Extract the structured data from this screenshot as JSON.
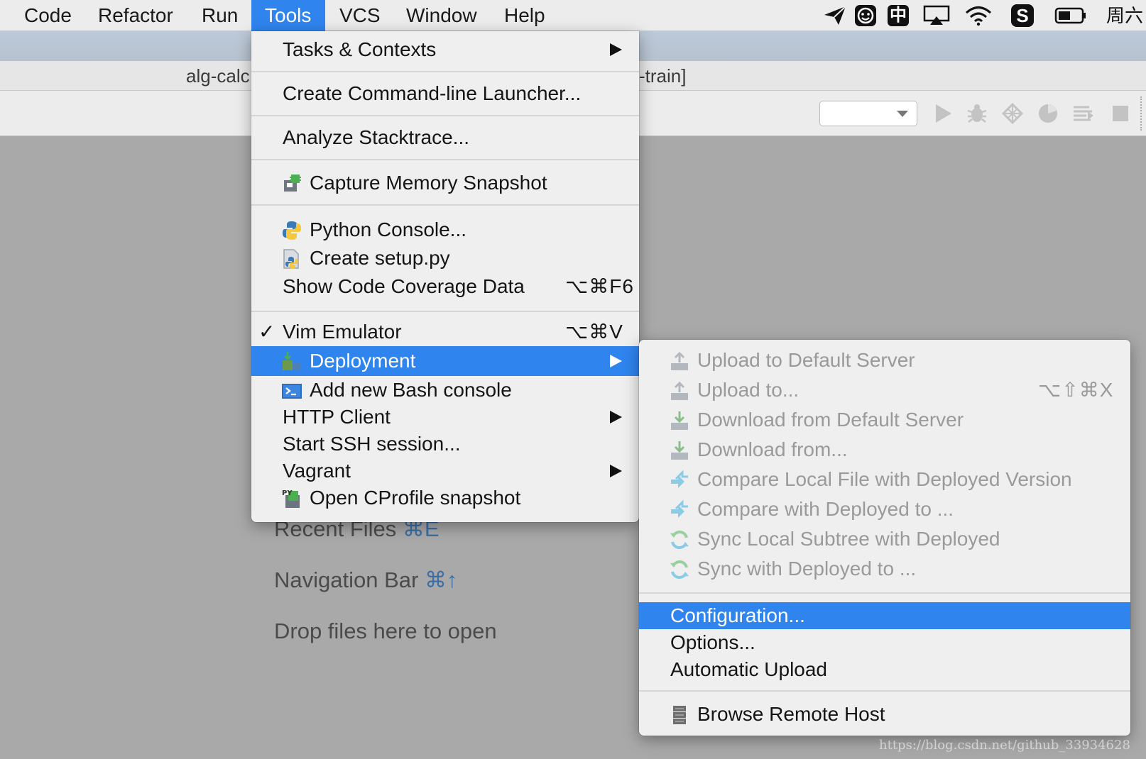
{
  "menubar": {
    "items": [
      {
        "label": "Code",
        "active": false
      },
      {
        "label": "Refactor",
        "active": false
      },
      {
        "label": "Run",
        "active": false
      },
      {
        "label": "Tools",
        "active": true
      },
      {
        "label": "VCS",
        "active": false
      },
      {
        "label": "Window",
        "active": false
      },
      {
        "label": "Help",
        "active": false
      }
    ],
    "status_icons": [
      "send-icon",
      "smiley-icon",
      "input-method-icon",
      "airplay-icon",
      "wifi-icon",
      "sogou-icon",
      "battery-icon"
    ],
    "input_method_label": "中",
    "sogou_label": "S",
    "clock_text": "周六"
  },
  "window": {
    "title_left": "alg-calc",
    "title_right": "-train]"
  },
  "welcome": {
    "recent_files_label": "Recent Files",
    "recent_files_shortcut": "⌘E",
    "navigation_bar_label": "Navigation Bar",
    "navigation_bar_shortcut": "⌘↑",
    "drop_files_label": "Drop files here to open"
  },
  "tools_menu": {
    "tasks_contexts": "Tasks & Contexts",
    "create_launcher": "Create Command-line Launcher...",
    "analyze_stacktrace": "Analyze Stacktrace...",
    "capture_memory": "Capture Memory Snapshot",
    "python_console": "Python Console...",
    "create_setup": "Create setup.py",
    "show_coverage": "Show Code Coverage Data",
    "show_coverage_shortcut": "⌥⌘F6",
    "vim_emulator": "Vim Emulator",
    "vim_checked": "✓",
    "vim_shortcut": "⌥⌘V",
    "deployment": "Deployment",
    "add_bash": "Add new Bash console",
    "http_client": "HTTP Client",
    "start_ssh": "Start SSH session...",
    "vagrant": "Vagrant",
    "open_cprofile": "Open CProfile snapshot"
  },
  "deployment_menu": {
    "upload_default": "Upload to Default Server",
    "upload_to": "Upload to...",
    "upload_to_shortcut": "⌥⇧⌘X",
    "download_default": "Download from Default Server",
    "download_from": "Download from...",
    "compare_local": "Compare Local File with Deployed Version",
    "compare_with": "Compare with Deployed to ...",
    "sync_subtree": "Sync Local Subtree with Deployed",
    "sync_with": "Sync with Deployed to ...",
    "configuration": "Configuration...",
    "options": "Options...",
    "automatic_upload": "Automatic Upload",
    "browse_remote": "Browse Remote Host"
  },
  "watermark": "https://blog.csdn.net/github_33934628",
  "colors": {
    "highlight": "#2f84ee",
    "menu_bg": "#efefef",
    "disabled_text": "#9a9a9a"
  }
}
